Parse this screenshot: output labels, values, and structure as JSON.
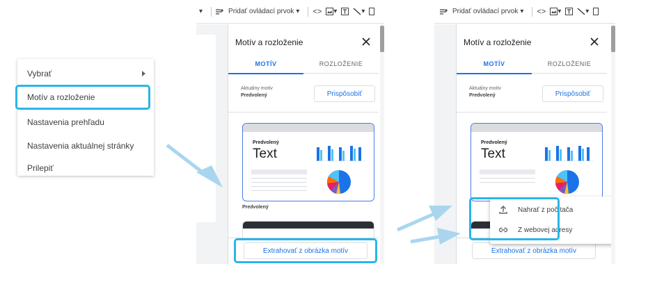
{
  "context_menu": {
    "items": [
      {
        "label": "Vybrať",
        "has_submenu": true
      },
      {
        "label": "Motív a rozloženie",
        "has_submenu": false
      },
      {
        "label": "Nastavenia prehľadu",
        "has_submenu": false
      },
      {
        "label": "Nastavenia aktuálnej stránky",
        "has_submenu": false
      },
      {
        "label": "Prilepiť",
        "has_submenu": false
      }
    ]
  },
  "toolbar": {
    "add_control_label": "Pridať ovládací prvok"
  },
  "theme_panel": {
    "title": "Motív a rozloženie",
    "tabs": [
      {
        "label": "MOTÍV",
        "active": true
      },
      {
        "label": "ROZLOŽENIE",
        "active": false
      }
    ],
    "current_theme_label": "Aktuálny motív",
    "current_theme_value": "Predvolený",
    "customize_button": "Prispôsobiť",
    "theme_card": {
      "name": "Predvolený",
      "sample_text": "Text",
      "caption": "Predvolený"
    },
    "extract_button": "Extrahovať z obrázka motív"
  },
  "upload_menu": {
    "items": [
      {
        "label": "Nahrať z počítača",
        "icon": "upload-icon"
      },
      {
        "label": "Z webovej adresy",
        "icon": "link-icon"
      }
    ]
  },
  "colors": {
    "highlight": "#29b5e8",
    "accent_blue": "#1a73e8",
    "arrow": "#a9d6ee"
  }
}
